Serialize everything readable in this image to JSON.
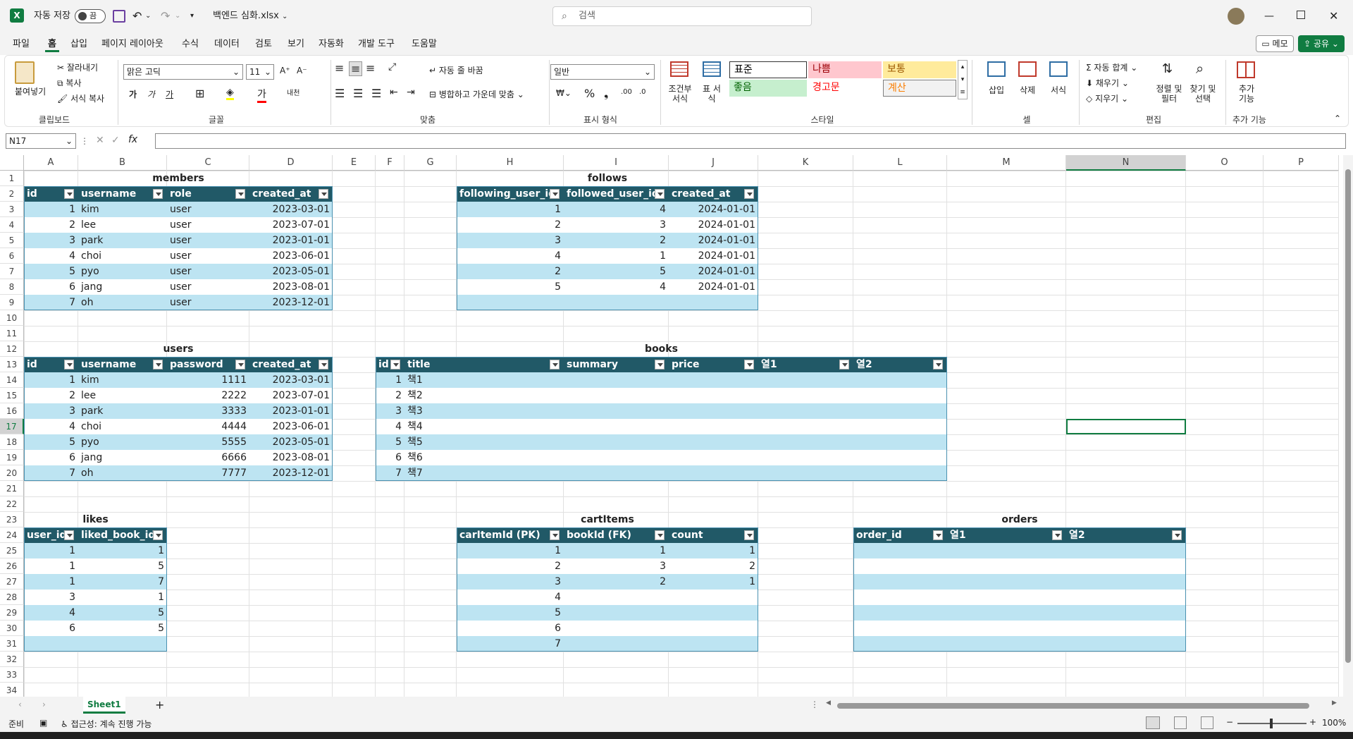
{
  "title": {
    "autosave_label": "자동 저장",
    "autosave_state": "끔",
    "filename": "백엔드 심화.xlsx",
    "search_placeholder": "검색"
  },
  "menu": [
    "파일",
    "홈",
    "삽입",
    "페이지 레이아웃",
    "수식",
    "데이터",
    "검토",
    "보기",
    "자동화",
    "개발 도구",
    "도움말"
  ],
  "menu_active": 1,
  "memo_label": "메모",
  "share_label": "공유",
  "ribbon": {
    "paste": "붙여넣기",
    "cut": "잘라내기",
    "copy": "복사",
    "format_painter": "서식 복사",
    "clipboard_group": "클립보드",
    "font_name": "맑은 고딕",
    "font_size": "11",
    "font_group": "글꼴",
    "wrap_text": "자동 줄 바꿈",
    "merge_center": "병합하고 가운데 맞춤",
    "alignment_group": "맞춤",
    "number_format": "일반",
    "number_group": "표시 형식",
    "cond_format": "조건부 서식",
    "table_format": "표 서식",
    "styles": [
      {
        "label": "표준",
        "bg": "#ffffff",
        "fg": "#000000"
      },
      {
        "label": "나쁨",
        "bg": "#ffc7ce",
        "fg": "#9c0006"
      },
      {
        "label": "보통",
        "bg": "#ffeb9c",
        "fg": "#9c5700"
      },
      {
        "label": "좋음",
        "bg": "#c6efce",
        "fg": "#006100"
      },
      {
        "label": "경고문",
        "bg": "#ffffff",
        "fg": "#ff0000"
      },
      {
        "label": "계산",
        "bg": "#f2f2f2",
        "fg": "#fa7d00"
      }
    ],
    "styles_group": "스타일",
    "insert": "삽입",
    "delete": "삭제",
    "format": "서식",
    "cells_group": "셀",
    "autosum": "자동 합계",
    "fill": "채우기",
    "clear": "지우기",
    "sort_filter": "정렬 및 필터",
    "find_select": "찾기 및 선택",
    "editing_group": "편집",
    "addins": "추가 기능",
    "addins_group": "추가 기능"
  },
  "formula_bar": {
    "name_box": "N17",
    "fx": "fx",
    "value": ""
  },
  "columns": [
    "A",
    "B",
    "C",
    "D",
    "E",
    "F",
    "G",
    "H",
    "I",
    "J",
    "K",
    "L",
    "M",
    "N",
    "O",
    "P"
  ],
  "rows": [
    "1",
    "2",
    "3",
    "4",
    "5",
    "6",
    "7",
    "8",
    "9",
    "10",
    "11",
    "12",
    "13",
    "14",
    "15",
    "16",
    "17",
    "18",
    "19",
    "20",
    "21",
    "22",
    "23",
    "24",
    "25",
    "26",
    "27",
    "28",
    "29",
    "30",
    "31",
    "32",
    "33",
    "34"
  ],
  "active_cell": "N17",
  "tables": {
    "members": {
      "title": "members",
      "headers": [
        "id",
        "username",
        "role",
        "created_at"
      ],
      "rows": [
        [
          "1",
          "kim",
          "user",
          "2023-03-01"
        ],
        [
          "2",
          "lee",
          "user",
          "2023-07-01"
        ],
        [
          "3",
          "park",
          "user",
          "2023-01-01"
        ],
        [
          "4",
          "choi",
          "user",
          "2023-06-01"
        ],
        [
          "5",
          "pyo",
          "user",
          "2023-05-01"
        ],
        [
          "6",
          "jang",
          "user",
          "2023-08-01"
        ],
        [
          "7",
          "oh",
          "user",
          "2023-12-01"
        ]
      ]
    },
    "follows": {
      "title": "follows",
      "headers": [
        "following_user_id",
        "followed_user_id",
        "created_at"
      ],
      "rows": [
        [
          "1",
          "4",
          "2024-01-01"
        ],
        [
          "2",
          "3",
          "2024-01-01"
        ],
        [
          "3",
          "2",
          "2024-01-01"
        ],
        [
          "4",
          "1",
          "2024-01-01"
        ],
        [
          "2",
          "5",
          "2024-01-01"
        ],
        [
          "5",
          "4",
          "2024-01-01"
        ],
        [
          "",
          "",
          ""
        ]
      ]
    },
    "users": {
      "title": "users",
      "headers": [
        "id",
        "username",
        "password",
        "created_at"
      ],
      "rows": [
        [
          "1",
          "kim",
          "1111",
          "2023-03-01"
        ],
        [
          "2",
          "lee",
          "2222",
          "2023-07-01"
        ],
        [
          "3",
          "park",
          "3333",
          "2023-01-01"
        ],
        [
          "4",
          "choi",
          "4444",
          "2023-06-01"
        ],
        [
          "5",
          "pyo",
          "5555",
          "2023-05-01"
        ],
        [
          "6",
          "jang",
          "6666",
          "2023-08-01"
        ],
        [
          "7",
          "oh",
          "7777",
          "2023-12-01"
        ]
      ]
    },
    "books": {
      "title": "books",
      "headers": [
        "id",
        "title",
        "summary",
        "price",
        "열1",
        "열2"
      ],
      "rows": [
        [
          "1",
          "책1",
          "",
          "",
          "",
          ""
        ],
        [
          "2",
          "책2",
          "",
          "",
          "",
          ""
        ],
        [
          "3",
          "책3",
          "",
          "",
          "",
          ""
        ],
        [
          "4",
          "책4",
          "",
          "",
          "",
          ""
        ],
        [
          "5",
          "책5",
          "",
          "",
          "",
          ""
        ],
        [
          "6",
          "책6",
          "",
          "",
          "",
          ""
        ],
        [
          "7",
          "책7",
          "",
          "",
          "",
          ""
        ]
      ]
    },
    "likes": {
      "title": "likes",
      "headers": [
        "user_id",
        "liked_book_id"
      ],
      "rows": [
        [
          "1",
          "1"
        ],
        [
          "1",
          "5"
        ],
        [
          "1",
          "7"
        ],
        [
          "3",
          "1"
        ],
        [
          "4",
          "5"
        ],
        [
          "6",
          "5"
        ],
        [
          "",
          ""
        ]
      ]
    },
    "cartItems": {
      "title": "cartItems",
      "headers": [
        "carItemId (PK)",
        "bookId (FK)",
        "count"
      ],
      "rows": [
        [
          "1",
          "1",
          "1"
        ],
        [
          "2",
          "3",
          "2"
        ],
        [
          "3",
          "2",
          "1"
        ],
        [
          "4",
          "",
          ""
        ],
        [
          "5",
          "",
          ""
        ],
        [
          "6",
          "",
          ""
        ],
        [
          "7",
          "",
          ""
        ]
      ]
    },
    "orders": {
      "title": "orders",
      "headers": [
        "order_id",
        "열1",
        "열2"
      ],
      "rows": [
        [
          "",
          "",
          ""
        ],
        [
          "",
          "",
          ""
        ],
        [
          "",
          "",
          ""
        ],
        [
          "",
          "",
          ""
        ],
        [
          "",
          "",
          ""
        ],
        [
          "",
          "",
          ""
        ],
        [
          "",
          "",
          ""
        ]
      ]
    }
  },
  "sheet_tab": "Sheet1",
  "status": {
    "ready": "준비",
    "accessibility": "접근성: 계속 진행 가능",
    "zoom": "100%"
  },
  "colors": {
    "header_bg": "#215967",
    "band": "#bde4f2",
    "accent": "#107c41"
  }
}
